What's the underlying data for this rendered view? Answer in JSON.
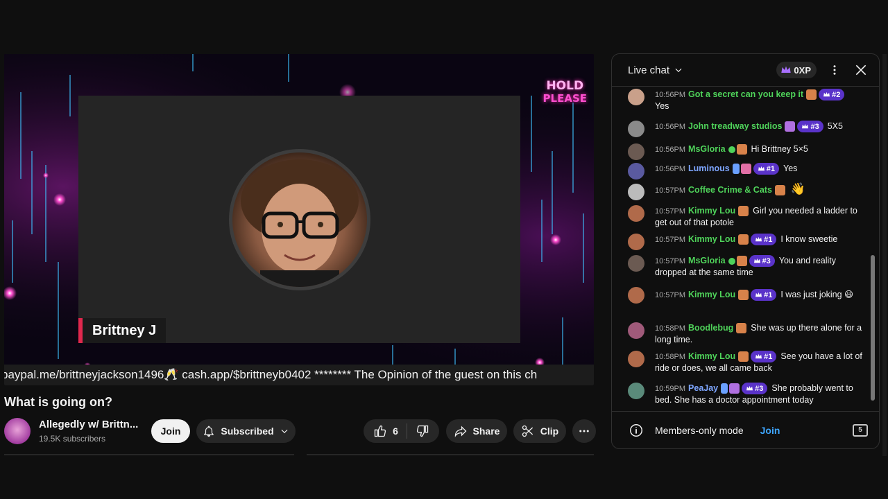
{
  "video": {
    "guest_name": "Brittney J",
    "hold_line1": "HOLD",
    "hold_line2": "PLEASE",
    "ticker": "paypal.me/brittneyjackson1496🥂 cash.app/$brittneyb0402 ******** The Opinion of the guest on this ch"
  },
  "meta": {
    "title": "What is going on?",
    "channel_name": "Allegedly w/ Brittn...",
    "subscribers": "19.5K subscribers",
    "join_label": "Join",
    "subscribed_label": "Subscribed",
    "like_count": "6",
    "share_label": "Share",
    "clip_label": "Clip"
  },
  "chat": {
    "title": "Live chat",
    "xp": "0XP",
    "footer_text": "Members-only mode",
    "footer_join": "Join",
    "footer_badge": "5",
    "messages": [
      {
        "ts": "10:56PM",
        "author": "Got a secret can you keep it",
        "badge": "#2",
        "text": "Yes",
        "color": "green"
      },
      {
        "ts": "10:56PM",
        "author": "John treadway studios",
        "badge": "#3",
        "text": "5X5",
        "color": "green"
      },
      {
        "ts": "10:56PM",
        "author": "MsGloria",
        "badge": "",
        "text": "Hi Brittney 5×5",
        "color": "green"
      },
      {
        "ts": "10:56PM",
        "author": "Luminous",
        "badge": "#1",
        "text": "Yes",
        "color": "blue"
      },
      {
        "ts": "10:57PM",
        "author": "Coffee Crime & Cats",
        "badge": "",
        "text": "👋",
        "color": "green"
      },
      {
        "ts": "10:57PM",
        "author": "Kimmy Lou",
        "badge": "",
        "text": "Girl you needed a ladder to get out of that potole",
        "color": "green"
      },
      {
        "ts": "10:57PM",
        "author": "Kimmy Lou",
        "badge": "#1",
        "text": "I know sweetie",
        "color": "green"
      },
      {
        "ts": "10:57PM",
        "author": "MsGloria",
        "badge": "#3",
        "text": "You and reality dropped at the same time",
        "color": "green"
      },
      {
        "ts": "10:57PM",
        "author": "Kimmy Lou",
        "badge": "#1",
        "text": "I was just joking 😃",
        "color": "green"
      },
      {
        "ts": "10:58PM",
        "author": "Boodlebug",
        "badge": "",
        "text": "She was up there alone for a long time.",
        "color": "green"
      },
      {
        "ts": "10:58PM",
        "author": "Kimmy Lou",
        "badge": "#1",
        "text": "See you have a lot of ride or does, we all came back",
        "color": "green"
      },
      {
        "ts": "10:59PM",
        "author": "PeaJay",
        "badge": "#3",
        "text": "She probably went to bed. She has a doctor appointment today",
        "color": "blue"
      }
    ]
  }
}
